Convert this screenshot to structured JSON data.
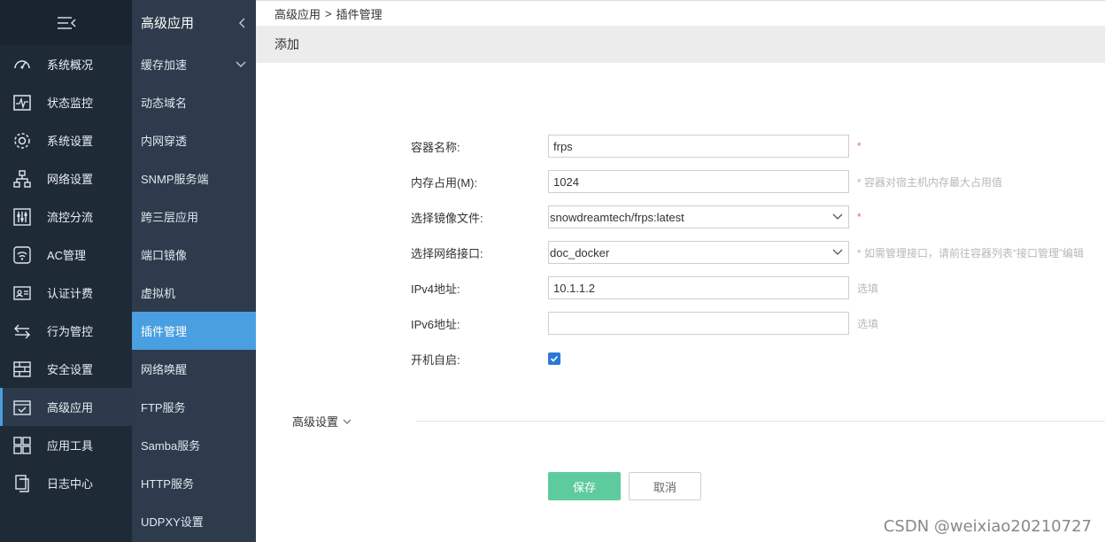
{
  "primary_nav": [
    {
      "icon": "dashboard-icon",
      "label": "系统概况"
    },
    {
      "icon": "monitor-icon",
      "label": "状态监控"
    },
    {
      "icon": "gear-icon",
      "label": "系统设置"
    },
    {
      "icon": "network-icon",
      "label": "网络设置"
    },
    {
      "icon": "sliders-icon",
      "label": "流控分流"
    },
    {
      "icon": "wifi-icon",
      "label": "AC管理"
    },
    {
      "icon": "id-card-icon",
      "label": "认证计费"
    },
    {
      "icon": "swap-icon",
      "label": "行为管控"
    },
    {
      "icon": "firewall-icon",
      "label": "安全设置"
    },
    {
      "icon": "app-icon",
      "label": "高级应用"
    },
    {
      "icon": "tools-icon",
      "label": "应用工具"
    },
    {
      "icon": "log-icon",
      "label": "日志中心"
    }
  ],
  "secondary_nav": {
    "title": "高级应用",
    "items": [
      {
        "label": "缓存加速"
      },
      {
        "label": "动态域名"
      },
      {
        "label": "内网穿透"
      },
      {
        "label": "SNMP服务端"
      },
      {
        "label": "跨三层应用"
      },
      {
        "label": "端口镜像"
      },
      {
        "label": "虚拟机"
      },
      {
        "label": "插件管理"
      },
      {
        "label": "网络唤醒"
      },
      {
        "label": "FTP服务"
      },
      {
        "label": "Samba服务"
      },
      {
        "label": "HTTP服务"
      },
      {
        "label": "UDPXY设置"
      }
    ]
  },
  "breadcrumb": {
    "parent": "高级应用",
    "separator": ">",
    "current": "插件管理"
  },
  "subheader": {
    "title": "添加"
  },
  "form": {
    "container_name": {
      "label": "容器名称:",
      "value": "frps",
      "required": "*"
    },
    "memory": {
      "label": "内存占用(M):",
      "value": "1024",
      "hint": "* 容器对宿主机内存最大占用值"
    },
    "image": {
      "label": "选择镜像文件:",
      "value": "snowdreamtech/frps:latest",
      "required": "*"
    },
    "interface": {
      "label": "选择网络接口:",
      "value": "doc_docker",
      "hint": "* 如需管理接口，请前往容器列表“接口管理”编辑"
    },
    "ipv4": {
      "label": "IPv4地址:",
      "value": "10.1.1.2",
      "hint": "选填"
    },
    "ipv6": {
      "label": "IPv6地址:",
      "value": "",
      "hint": "选填"
    },
    "autostart": {
      "label": "开机自启:",
      "checked": true
    }
  },
  "advanced": {
    "label": "高级设置"
  },
  "buttons": {
    "save": "保存",
    "cancel": "取消"
  },
  "watermark": "CSDN @weixiao20210727",
  "colors": {
    "sidebar_dark": "#1f2a37",
    "sidebar_secondary": "#2d3b4c",
    "active_blue": "#4a9fe0",
    "save_green": "#5ecb9e",
    "required_red": "#f06a5a"
  }
}
